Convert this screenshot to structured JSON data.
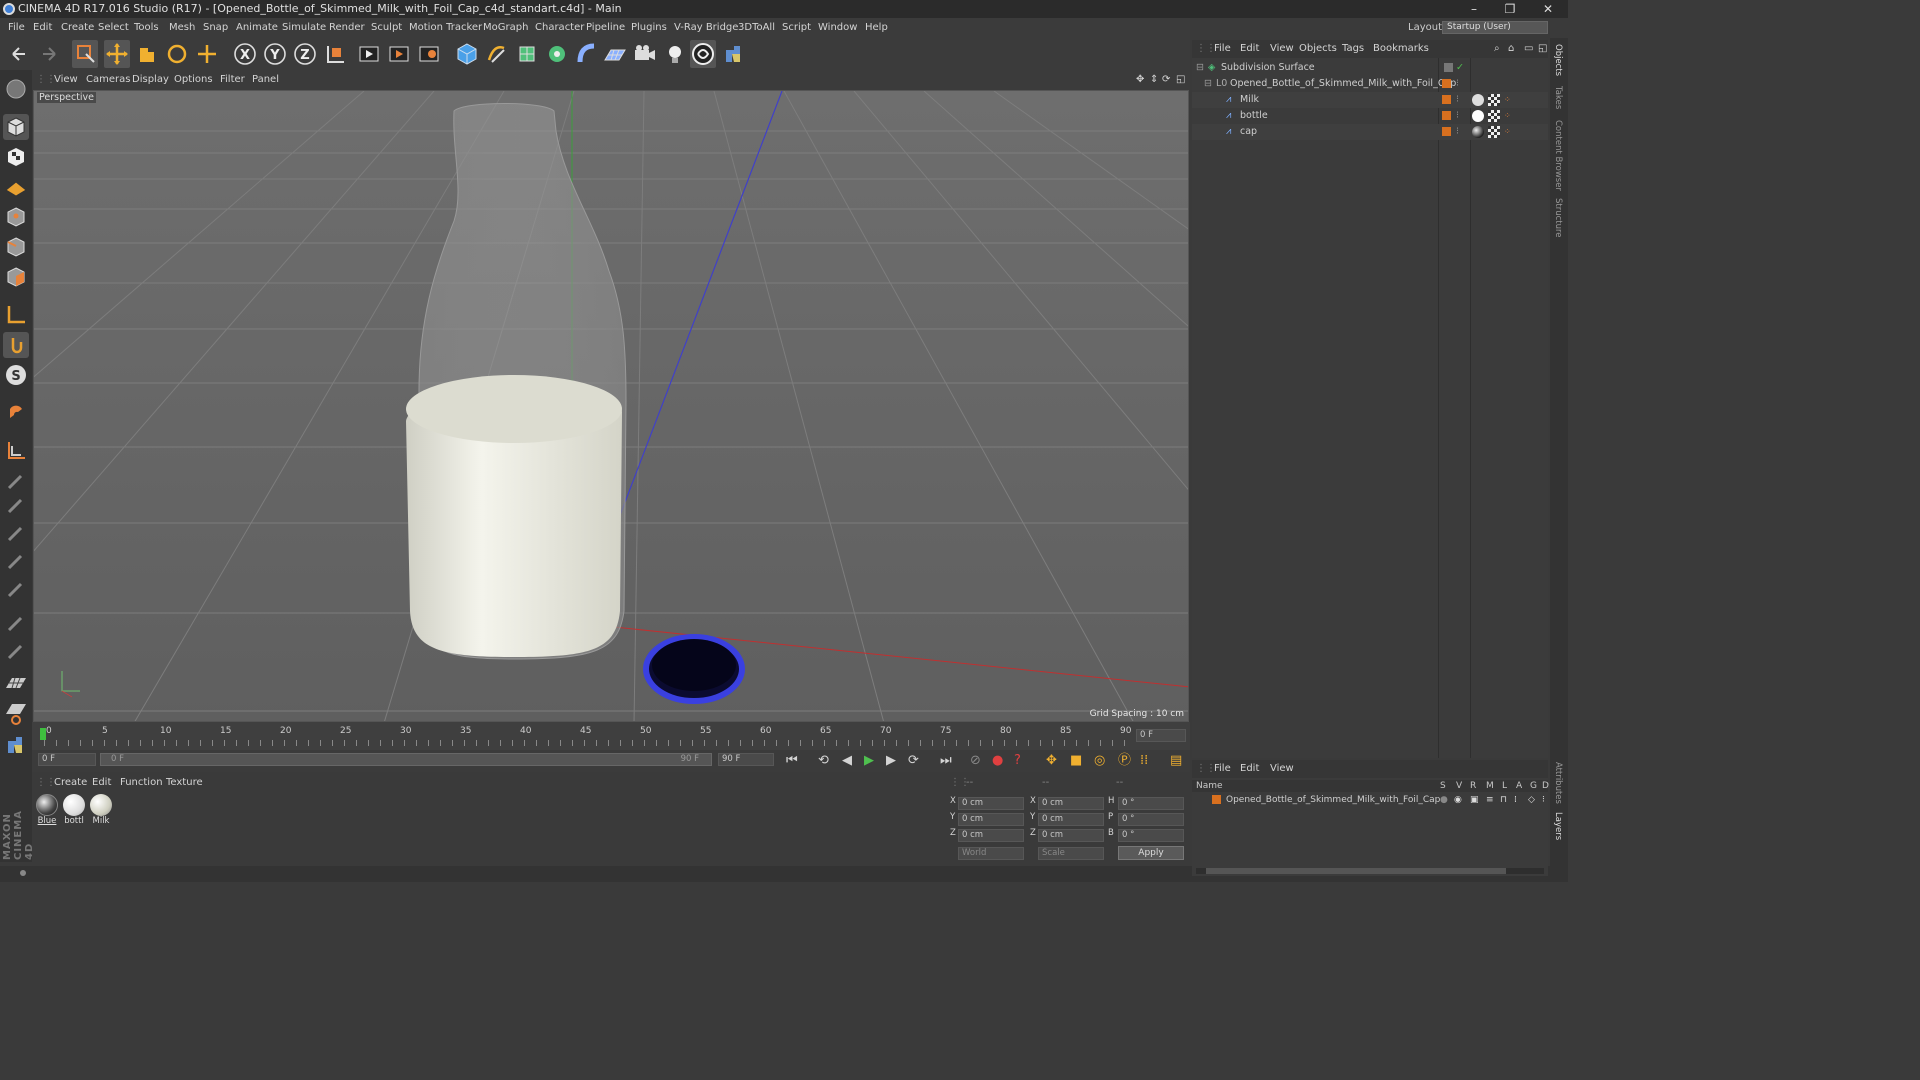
{
  "window": {
    "title": "CINEMA 4D R17.016 Studio (R17) - [Opened_Bottle_of_Skimmed_Milk_with_Foil_Cap_c4d_standart.c4d] - Main",
    "minimize": "–",
    "restore": "❐",
    "close": "✕"
  },
  "menu": [
    "File",
    "Edit",
    "Create",
    "Select",
    "Tools",
    "Mesh",
    "Snap",
    "Animate",
    "Simulate",
    "Render",
    "Sculpt",
    "Motion Tracker",
    "MoGraph",
    "Character",
    "Pipeline",
    "Plugins",
    "V-Ray Bridge",
    "3DToAll",
    "Script",
    "Window",
    "Help"
  ],
  "layout": {
    "label": "Layout:",
    "value": "Startup (User)"
  },
  "viewport": {
    "menu": [
      "View",
      "Cameras",
      "Display",
      "Options",
      "Filter",
      "Panel"
    ],
    "label": "Perspective",
    "grid_spacing": "Grid Spacing : 10 cm"
  },
  "timeline": {
    "ticks": [
      "0",
      "5",
      "10",
      "15",
      "20",
      "25",
      "30",
      "35",
      "40",
      "45",
      "50",
      "55",
      "60",
      "65",
      "70",
      "75",
      "80",
      "85",
      "90"
    ],
    "frame_end_field": "0 F"
  },
  "playbar": {
    "start": "0 F",
    "scrub_start": "0 F",
    "scrub_end": "90 F",
    "end": "90 F"
  },
  "materials": {
    "menu": [
      "Create",
      "Edit",
      "Function",
      "Texture"
    ],
    "items": [
      "Blue",
      "bottl",
      "Milk"
    ]
  },
  "coords": {
    "headers": [
      "--",
      "--",
      "--"
    ],
    "rows": [
      {
        "a": "X",
        "av": "0 cm",
        "b": "X",
        "bv": "0 cm",
        "c": "H",
        "cv": "0 °"
      },
      {
        "a": "Y",
        "av": "0 cm",
        "b": "Y",
        "bv": "0 cm",
        "c": "P",
        "cv": "0 °"
      },
      {
        "a": "Z",
        "av": "0 cm",
        "b": "Z",
        "bv": "0 cm",
        "c": "B",
        "cv": "0 °"
      }
    ],
    "mode": "World",
    "scale": "Scale",
    "apply": "Apply"
  },
  "objects": {
    "menu": [
      "File",
      "Edit",
      "View",
      "Objects",
      "Tags",
      "Bookmarks"
    ],
    "items": [
      {
        "name": "Subdivision Surface",
        "indent": 0
      },
      {
        "name": "Opened_Bottle_of_Skimmed_Milk_with_Foil_Cap",
        "indent": 1
      },
      {
        "name": "Milk",
        "indent": 2
      },
      {
        "name": "bottle",
        "indent": 2
      },
      {
        "name": "cap",
        "indent": 2
      }
    ]
  },
  "attributes": {
    "menu": [
      "File",
      "Edit",
      "View"
    ],
    "columns": [
      "Name",
      "S",
      "V",
      "R",
      "M",
      "L",
      "A",
      "G",
      "D"
    ],
    "row": "Opened_Bottle_of_Skimmed_Milk_with_Foil_Cap"
  },
  "side_tabs": [
    "Objects",
    "Takes",
    "Content Browser",
    "Structure"
  ],
  "side_tabs_bottom": [
    "Attributes",
    "Layers"
  ],
  "maxon": "MAXON CINEMA 4D"
}
